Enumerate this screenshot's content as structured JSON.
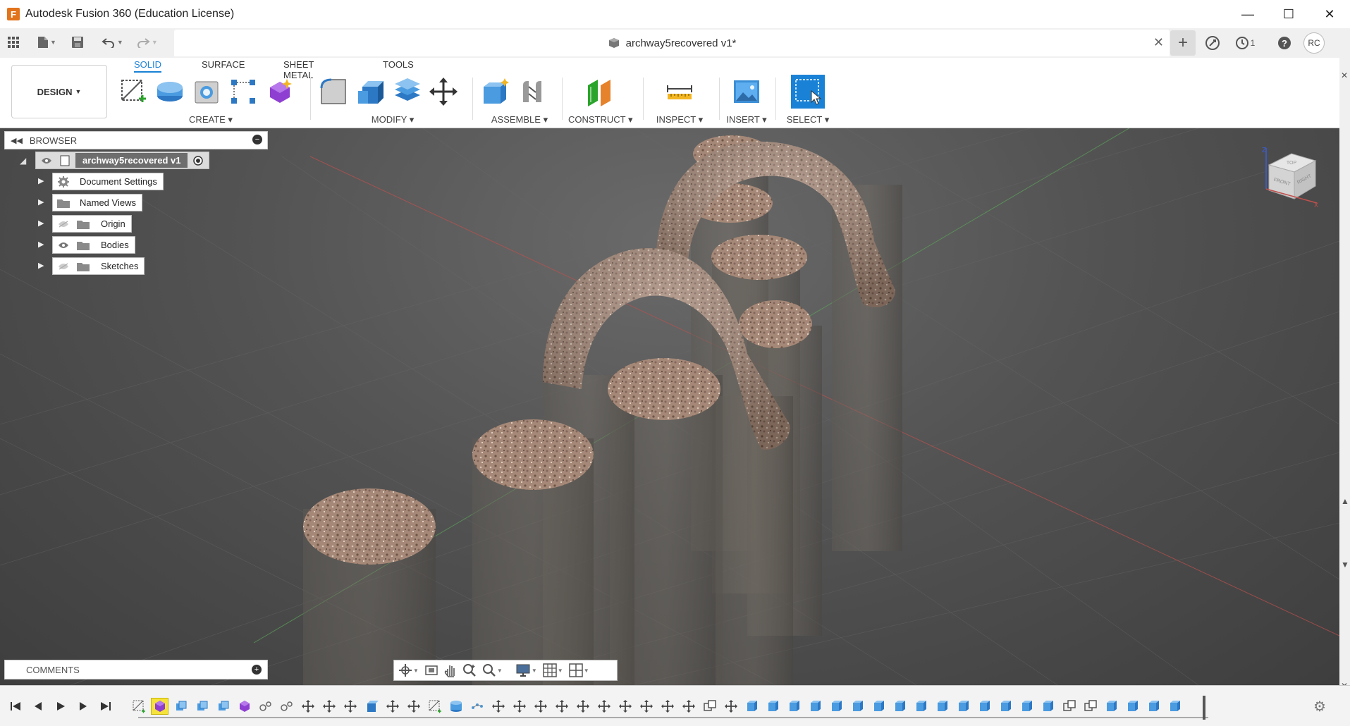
{
  "window": {
    "title": "Autodesk Fusion 360 (Education License)",
    "logo_letter": "F",
    "minimize": "—",
    "maximize": "☐",
    "close": "✕"
  },
  "document": {
    "tab_title": "archway5recovered v1*",
    "close_glyph": "✕",
    "job_count": "1",
    "user_initials": "RC"
  },
  "ribbon": {
    "workspace": "DESIGN",
    "tabs": [
      "SOLID",
      "SURFACE",
      "SHEET METAL",
      "TOOLS"
    ],
    "active_tab": "SOLID",
    "groups": [
      "CREATE ▾",
      "MODIFY ▾",
      "ASSEMBLE ▾",
      "CONSTRUCT ▾",
      "INSPECT ▾",
      "INSERT ▾",
      "SELECT ▾"
    ]
  },
  "browser": {
    "header": "BROWSER",
    "root": "archway5recovered v1",
    "items": [
      {
        "label": "Document Settings",
        "icon": "gear-icon",
        "eye": false
      },
      {
        "label": "Named Views",
        "icon": "folder-icon",
        "eye": false
      },
      {
        "label": "Origin",
        "icon": "folder-icon",
        "eye": "hidden"
      },
      {
        "label": "Bodies",
        "icon": "folder-icon",
        "eye": "visible"
      },
      {
        "label": "Sketches",
        "icon": "folder-icon",
        "eye": "hidden"
      }
    ]
  },
  "comments": {
    "label": "COMMENTS"
  },
  "viewcube": {
    "top": "TOP",
    "front": "FRONT",
    "right": "RIGHT",
    "axis_z": "Z",
    "axis_x": "X"
  },
  "colors": {
    "accent": "#1a82d6",
    "stone": "#a58877",
    "viewport_dark": "#3e3e3e",
    "timeline_selected": "#f5e33b"
  },
  "timeline": {
    "feature_count": 50,
    "selected_index": 1
  }
}
